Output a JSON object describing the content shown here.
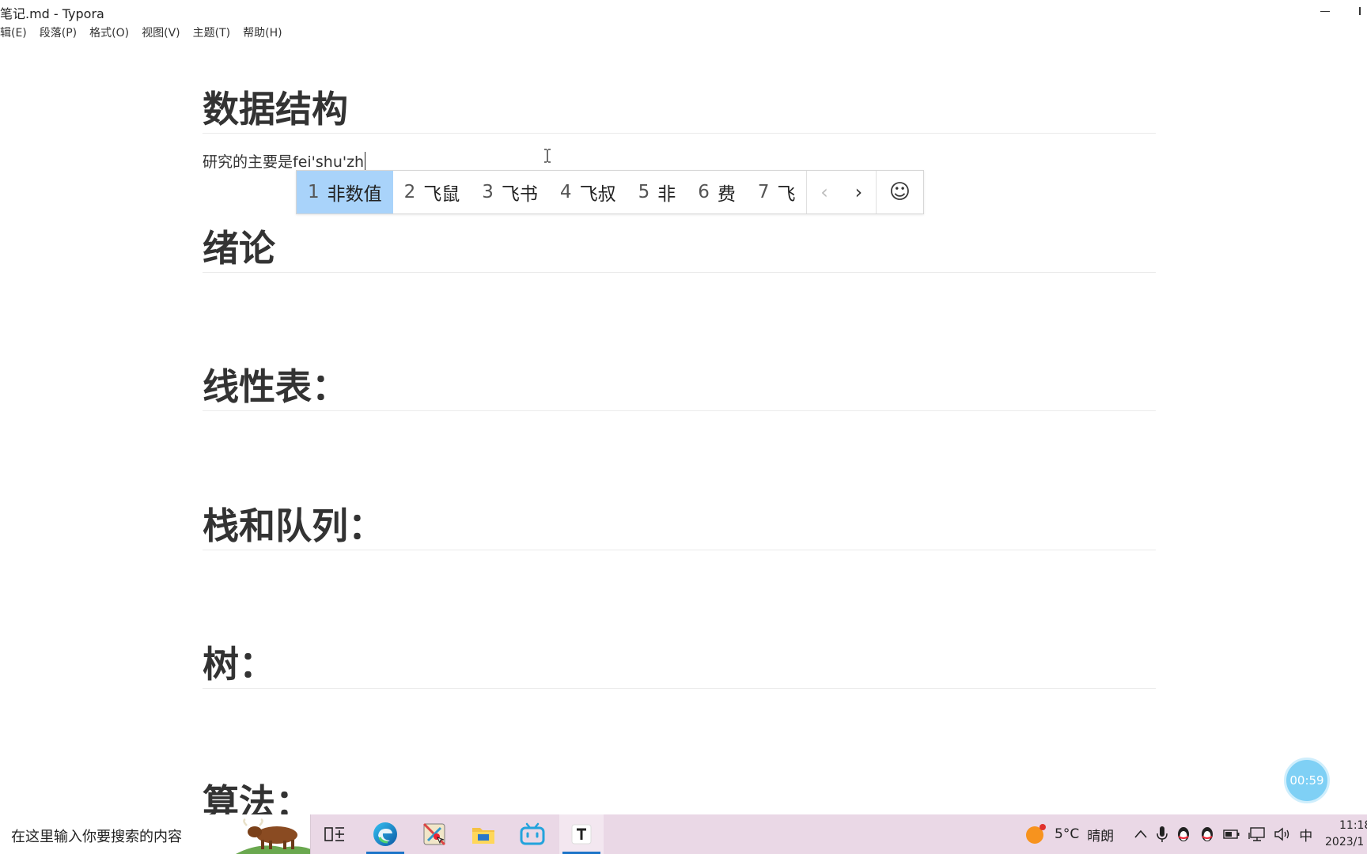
{
  "window": {
    "title": "笔记.md - Typora"
  },
  "menu": [
    "辑(E)",
    "段落(P)",
    "格式(O)",
    "视图(V)",
    "主题(T)",
    "帮助(H)"
  ],
  "document": {
    "heading_main": "数据结构",
    "paragraph": "研究的主要是fei'shu'zh",
    "headings": [
      "绪论",
      "线性表：",
      "栈和队列：",
      "树：",
      "算法："
    ]
  },
  "ime": {
    "candidates": [
      {
        "num": "1",
        "text": "非数值"
      },
      {
        "num": "2",
        "text": "飞鼠"
      },
      {
        "num": "3",
        "text": "飞书"
      },
      {
        "num": "4",
        "text": "飞叔"
      },
      {
        "num": "5",
        "text": "非"
      },
      {
        "num": "6",
        "text": "费"
      },
      {
        "num": "7",
        "text": "飞"
      }
    ],
    "prev_glyph": "‹",
    "next_glyph": "›",
    "emoji_glyph": "☺"
  },
  "timer": "00:59",
  "taskbar": {
    "search_placeholder": "在这里输入你要搜索的内容",
    "weather_temp": "5°C",
    "weather_desc": "晴朗",
    "ime_indicator": "中",
    "time": "11:18",
    "date": "2023/1"
  },
  "colors": {
    "accent": "#1c74c8",
    "ime_selected": "#a9d3fa",
    "taskbar_bg": "#ead8e6",
    "timer_bg": "#7fd0f5"
  }
}
